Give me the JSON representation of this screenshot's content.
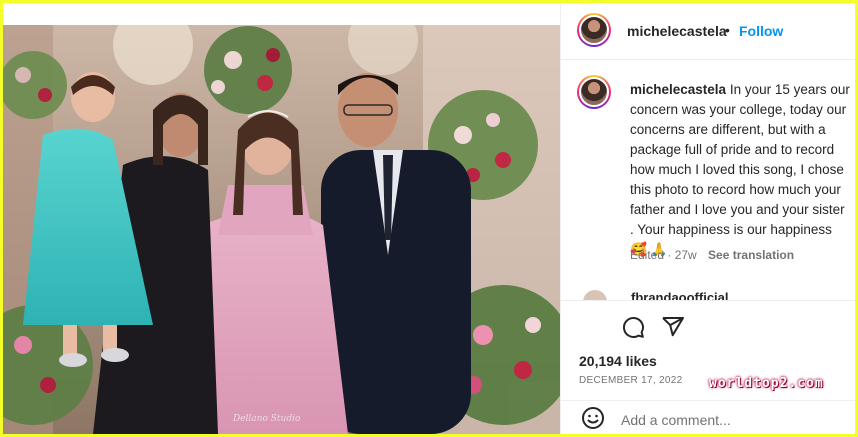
{
  "post": {
    "username": "michelecastela",
    "separator": "•",
    "follow_label": "Follow",
    "photo_signature": "Dellano Studio"
  },
  "caption": {
    "username": "michelecastela",
    "text": "In your 15 years our concern was your college, today our concerns are different, but with a package full of pride and to record how much I loved this song, I chose this photo to record how much your father and I love you and your sister . Your happiness is our happiness 🥰 🙏",
    "edited": "Edited · 27w",
    "see_translation": "See translation"
  },
  "next_comment": {
    "username": "fbrandaoofficial"
  },
  "stats": {
    "likes": "20,194 likes",
    "date": "DECEMBER 17, 2022"
  },
  "overlay": {
    "watermark": "worldtop2.com"
  },
  "comment_box": {
    "placeholder": "Add a comment..."
  },
  "icons": {
    "comment": "comment-icon",
    "share": "share-icon",
    "emoji": "emoji-icon"
  },
  "colors": {
    "accent": "#0095f6",
    "border": "#f4ff2a"
  }
}
